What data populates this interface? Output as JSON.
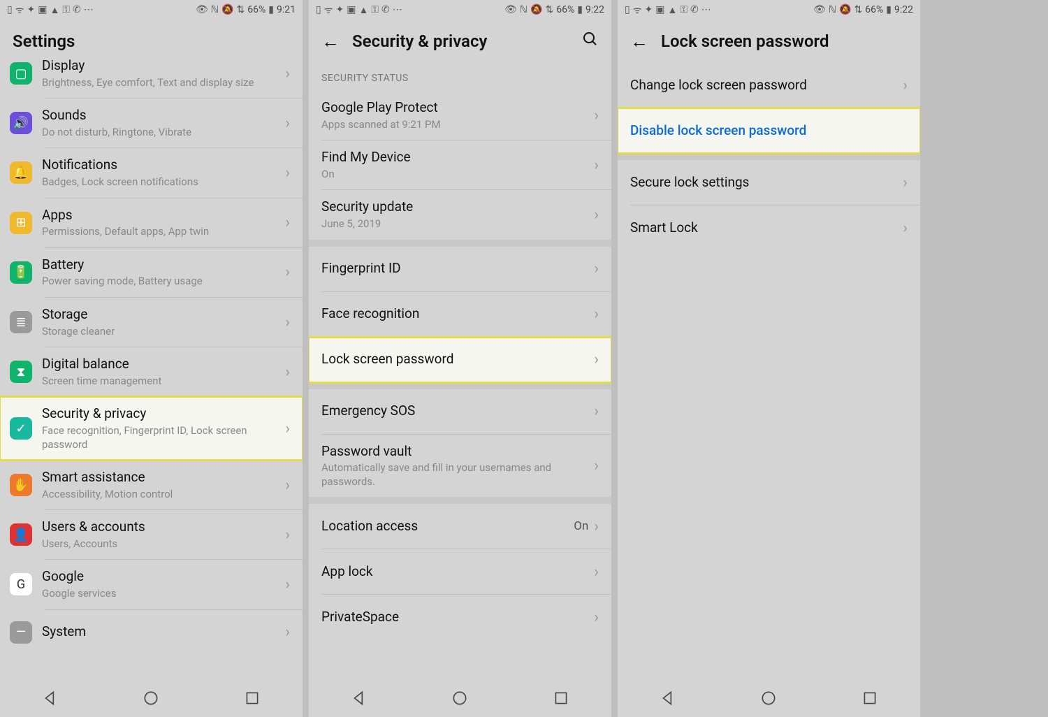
{
  "status": {
    "batteryText": "66%",
    "time1": "9:21",
    "time2": "9:22",
    "time3": "9:22"
  },
  "screen1": {
    "title": "Settings",
    "items": [
      {
        "title": "Display",
        "sub": "Brightness, Eye comfort, Text and display size",
        "icon": "display",
        "bgClass": "i-green"
      },
      {
        "title": "Sounds",
        "sub": "Do not disturb, Ringtone, Vibrate",
        "icon": "sound",
        "bgClass": "i-purple"
      },
      {
        "title": "Notifications",
        "sub": "Badges, Lock screen notifications",
        "icon": "bell",
        "bgClass": "i-yellow"
      },
      {
        "title": "Apps",
        "sub": "Permissions, Default apps, App twin",
        "icon": "apps",
        "bgClass": "i-yellow"
      },
      {
        "title": "Battery",
        "sub": "Power saving mode, Battery usage",
        "icon": "battery",
        "bgClass": "i-green"
      },
      {
        "title": "Storage",
        "sub": "Storage cleaner",
        "icon": "storage",
        "bgClass": "i-gray"
      },
      {
        "title": "Digital balance",
        "sub": "Screen time management",
        "icon": "hourglass",
        "bgClass": "i-green"
      },
      {
        "title": "Security & privacy",
        "sub": "Face recognition, Fingerprint ID, Lock screen password",
        "icon": "shield",
        "bgClass": "i-teal",
        "highlight": true
      },
      {
        "title": "Smart assistance",
        "sub": "Accessibility, Motion control",
        "icon": "hand",
        "bgClass": "i-orange"
      },
      {
        "title": "Users & accounts",
        "sub": "Users, Accounts",
        "icon": "user",
        "bgClass": "i-red"
      },
      {
        "title": "Google",
        "sub": "Google services",
        "icon": "google",
        "bgClass": "i-google"
      },
      {
        "title": "System",
        "sub": "",
        "icon": "system",
        "bgClass": "i-gray"
      }
    ]
  },
  "screen2": {
    "title": "Security & privacy",
    "sectionLabel": "SECURITY STATUS",
    "group1": [
      {
        "title": "Google Play Protect",
        "sub": "Apps scanned at 9:21 PM"
      },
      {
        "title": "Find My Device",
        "sub": "On"
      },
      {
        "title": "Security update",
        "sub": "June 5, 2019"
      }
    ],
    "group2": [
      {
        "title": "Fingerprint ID"
      },
      {
        "title": "Face recognition"
      },
      {
        "title": "Lock screen password",
        "highlight": true
      }
    ],
    "group3": [
      {
        "title": "Emergency SOS"
      },
      {
        "title": "Password vault",
        "sub": "Automatically save and fill in your usernames and passwords."
      }
    ],
    "group4": [
      {
        "title": "Location access",
        "value": "On"
      },
      {
        "title": "App lock"
      },
      {
        "title": "PrivateSpace"
      }
    ]
  },
  "screen3": {
    "title": "Lock screen password",
    "group1": [
      {
        "title": "Change lock screen password"
      },
      {
        "title": "Disable lock screen password",
        "highlight": true,
        "link": true
      }
    ],
    "group2": [
      {
        "title": "Secure lock settings"
      },
      {
        "title": "Smart Lock"
      }
    ]
  }
}
